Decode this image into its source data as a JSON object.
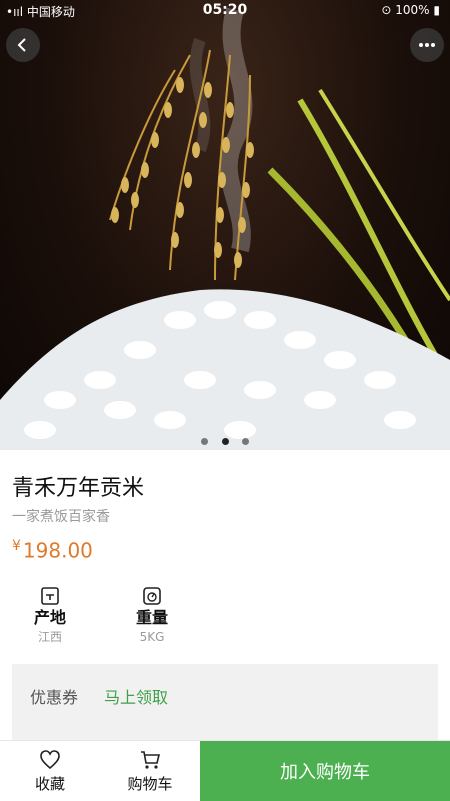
{
  "status_bar": {
    "carrier": "•ııl 中国移动 ",
    "time": "05:20",
    "battery": "⊙ 100% ▮"
  },
  "product": {
    "title": "青禾万年贡米",
    "subtitle": "一家煮饭百家香",
    "price_symbol": "¥",
    "price_value": "198.00",
    "specs": [
      {
        "label": "产地",
        "value": "江西"
      },
      {
        "label": "重量",
        "value": "5KG"
      }
    ]
  },
  "carousel": {
    "active_index": 1,
    "count": 3
  },
  "coupon": {
    "label": "优惠券",
    "action": "马上领取"
  },
  "bottom_bar": {
    "favorite_label": "收藏",
    "cart_label": "购物车",
    "add_to_cart_label": "加入购物车"
  },
  "colors": {
    "accent_green": "#4caf50",
    "price_orange": "#e07a2b",
    "link_green": "#3fa04a"
  },
  "icons": [
    "back-icon",
    "more-icon",
    "origin-icon",
    "weight-icon",
    "heart-icon",
    "cart-icon"
  ]
}
